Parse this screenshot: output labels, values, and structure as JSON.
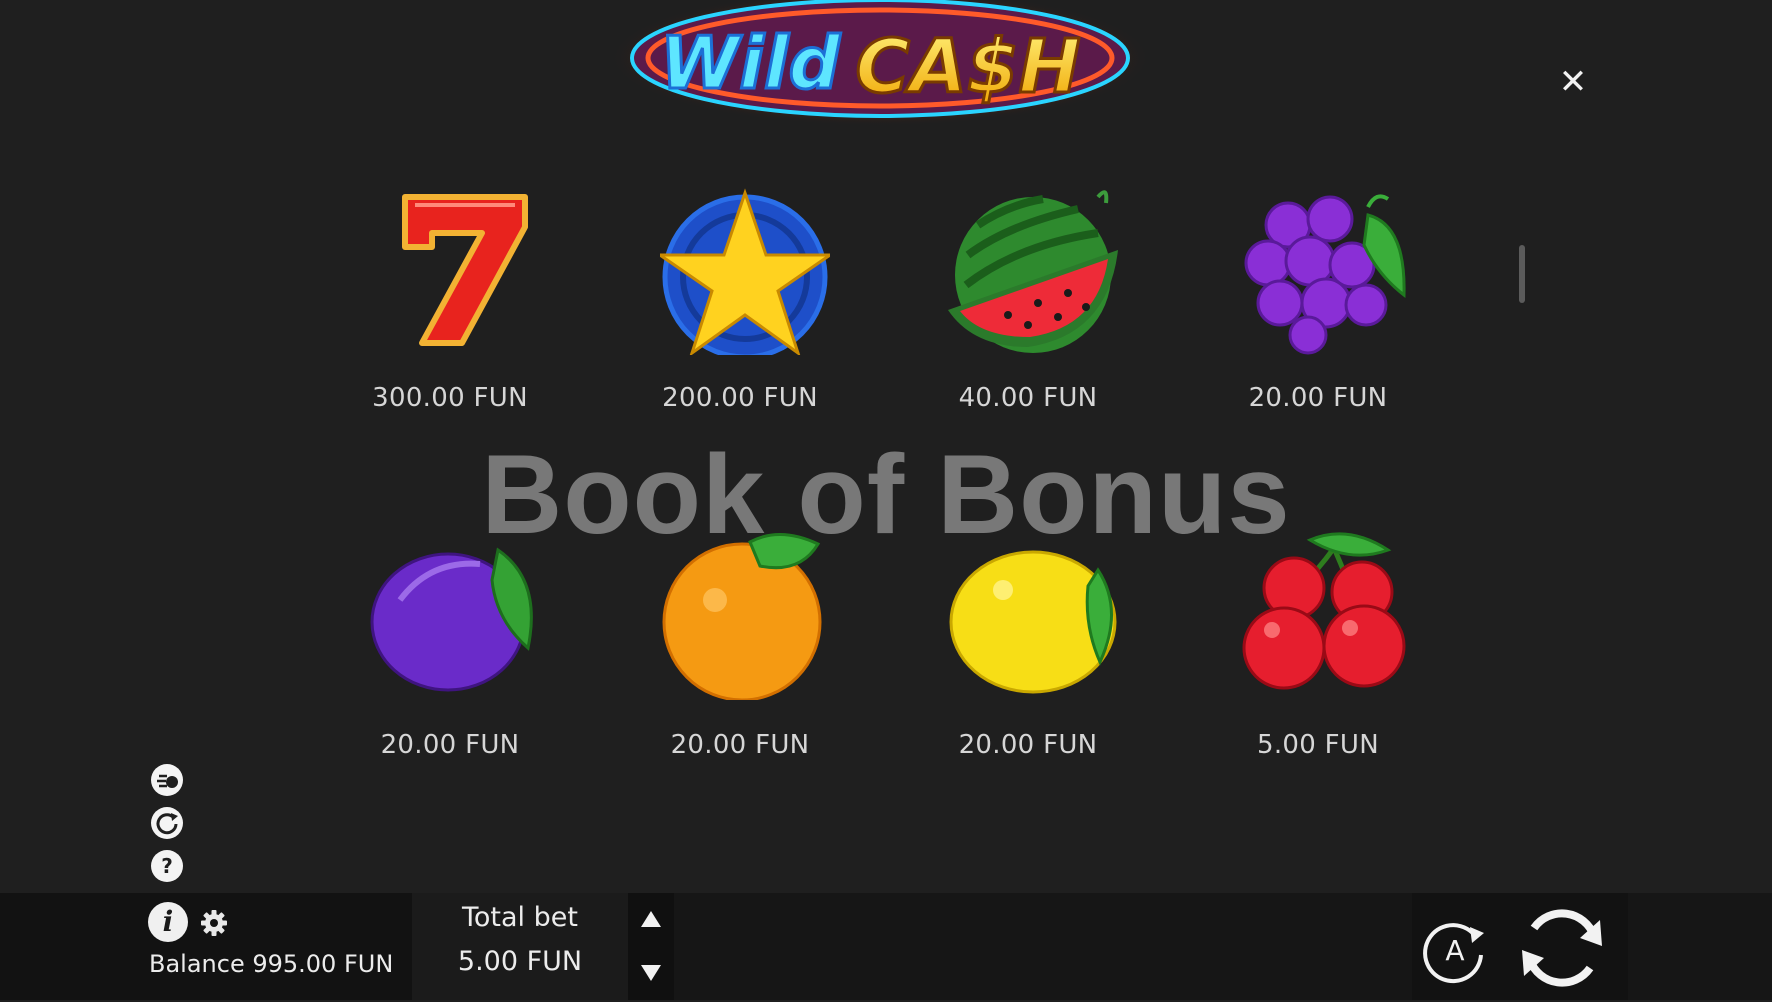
{
  "game": {
    "logo_text_1": "Wild",
    "logo_text_2": "CA$H"
  },
  "watermark": "Book of Bonus",
  "paytable": {
    "symbols": [
      {
        "icon": "seven-icon",
        "payout": "300.00 FUN"
      },
      {
        "icon": "star-icon",
        "payout": "200.00 FUN"
      },
      {
        "icon": "watermelon-icon",
        "payout": "40.00 FUN"
      },
      {
        "icon": "grapes-icon",
        "payout": "20.00 FUN"
      },
      {
        "icon": "plum-icon",
        "payout": "20.00 FUN"
      },
      {
        "icon": "orange-icon",
        "payout": "20.00 FUN"
      },
      {
        "icon": "lemon-icon",
        "payout": "20.00 FUN"
      },
      {
        "icon": "cherries-icon",
        "payout": "5.00 FUN"
      }
    ]
  },
  "side_menu": {
    "icons": [
      "bet-history-icon",
      "replay-icon",
      "help-icon"
    ],
    "help_glyph": "?"
  },
  "bottom_bar": {
    "info_glyph": "i",
    "balance": "Balance 995.00 FUN",
    "total_bet_label": "Total bet",
    "total_bet_value": "5.00 FUN",
    "autoplay_glyph": "A"
  },
  "close_glyph": "✕",
  "colors": {
    "background": "#1f1f1f",
    "bottom_bar": "#161616",
    "text": "#d6d6d6"
  }
}
